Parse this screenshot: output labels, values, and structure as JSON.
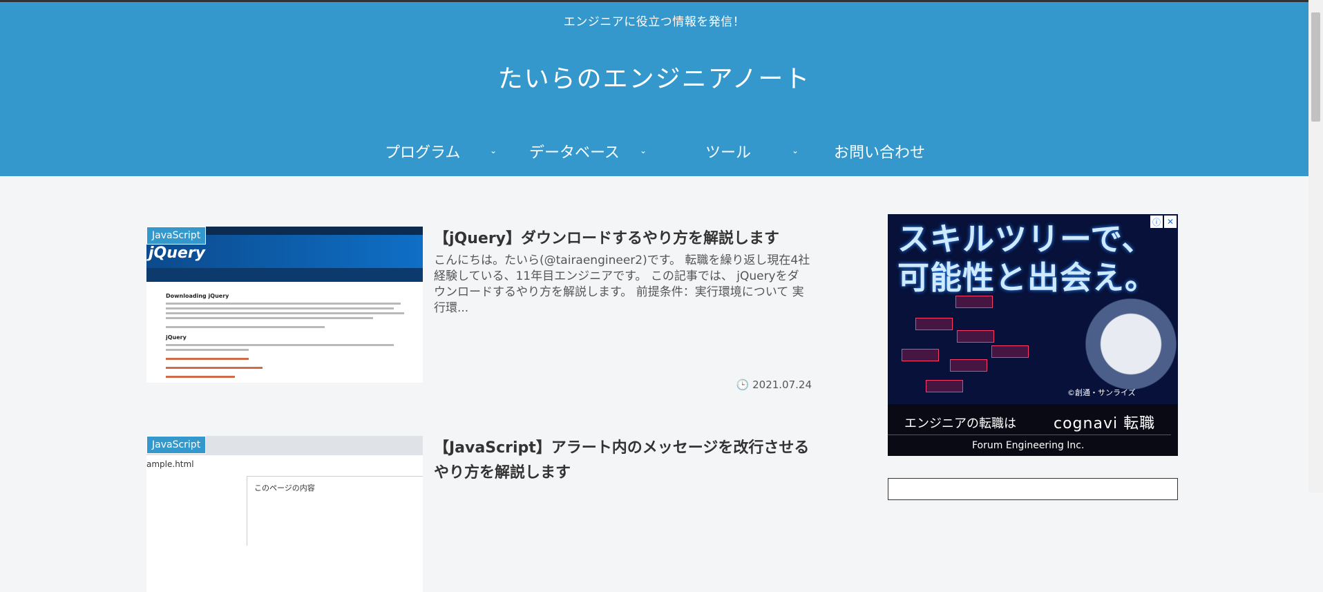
{
  "header": {
    "tagline": "エンジニアに役立つ情報を発信！",
    "site_title": "たいらのエンジニアノート",
    "nav": [
      {
        "label": "プログラム",
        "has_dropdown": true
      },
      {
        "label": "データベース",
        "has_dropdown": true
      },
      {
        "label": "ツール",
        "has_dropdown": true
      },
      {
        "label": "お問い合わせ",
        "has_dropdown": false
      }
    ]
  },
  "posts": [
    {
      "category": "JavaScript",
      "title": "【jQuery】ダウンロードするやり方を解説します",
      "excerpt": "こんにちは。たいら(@tairaengineer2)です。 転職を繰り返し現在4社経験している、11年目エンジニアです。 この記事では、 jQueryをダウンロードするやり方を解説します。 前提条件：実行環境について 実行環...",
      "date": "2021.07.24",
      "thumb": {
        "logo": "jQuery",
        "heading": "Downloading jQuery",
        "subheading": "jQuery"
      }
    },
    {
      "category": "JavaScript",
      "title": "【JavaScript】アラート内のメッセージを改行させるやり方を解説します",
      "thumb": {
        "file": "ample.html",
        "panel_text": "このページの内容"
      }
    }
  ],
  "ad": {
    "headline": "スキルツリーで、可能性と出会え。",
    "copyright": "©創通・サンライズ",
    "line1": "エンジニアの転職は",
    "brand": "cognavi 転職",
    "line2": "Forum Engineering Inc.",
    "info_icon": "info-icon",
    "close_icon": "close-icon"
  },
  "colors": {
    "header_bg": "#3498cd",
    "page_bg": "#f4f5f7",
    "badge_bg": "#3498cd"
  }
}
